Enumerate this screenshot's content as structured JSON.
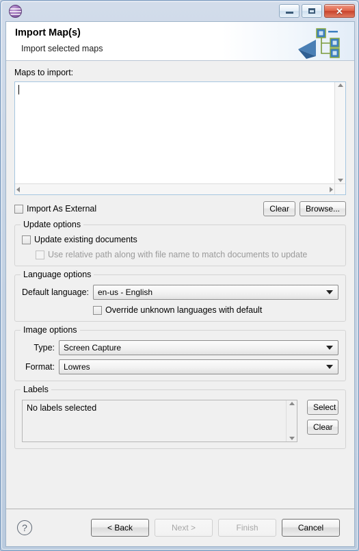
{
  "window": {
    "app_icon": "globe-icon",
    "controls": {
      "minimize": "minimize-icon",
      "maximize": "restore-icon",
      "close": "✕"
    }
  },
  "banner": {
    "title": "Import Map(s)",
    "subtitle": "Import selected maps",
    "art": "map-hierarchy-icon"
  },
  "maps": {
    "label": "Maps to import:",
    "value": "",
    "placeholder": ""
  },
  "import_external": {
    "label": "Import As External",
    "checked": false
  },
  "actions": {
    "clear_label": "Clear",
    "browse_label": "Browse..."
  },
  "update_options": {
    "title": "Update options",
    "update_existing": {
      "label": "Update existing documents",
      "checked": false,
      "enabled": true
    },
    "use_relative_path": {
      "label": "Use relative path along with file name to match documents to update",
      "checked": false,
      "enabled": false
    }
  },
  "language_options": {
    "title": "Language options",
    "default_language_label": "Default language:",
    "default_language_value": "en-us - English",
    "override_unknown": {
      "label": "Override unknown languages with default",
      "checked": false
    }
  },
  "image_options": {
    "title": "Image options",
    "type_label": "Type:",
    "type_value": "Screen Capture",
    "format_label": "Format:",
    "format_value": "Lowres"
  },
  "labels_section": {
    "title": "Labels",
    "empty_text": "No labels selected",
    "select_label": "Select",
    "clear_label": "Clear"
  },
  "footer": {
    "help": "?",
    "back_label": "< Back",
    "next_label": "Next >",
    "finish_label": "Finish",
    "cancel_label": "Cancel",
    "next_enabled": false,
    "finish_enabled": false
  },
  "colors": {
    "accent": "#3a6ea5",
    "frame": "#b9cade",
    "close_button": "#c8432c",
    "banner_bg": "#ffffff"
  }
}
